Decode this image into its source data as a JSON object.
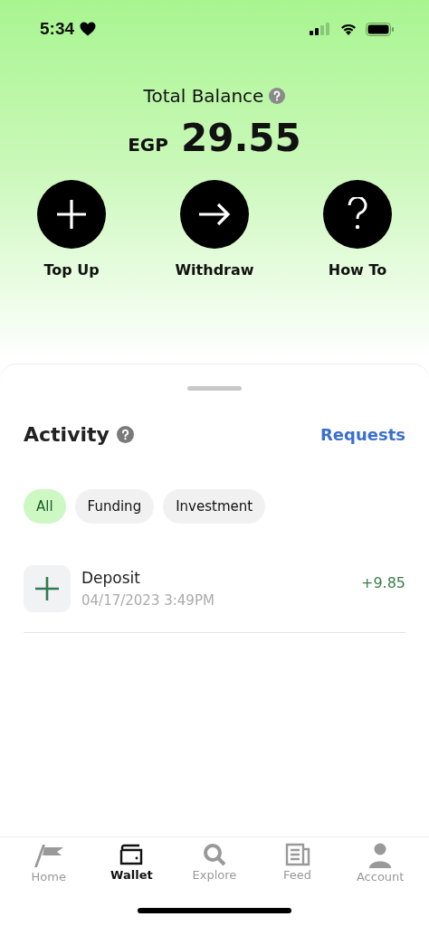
{
  "status_bar": {
    "time": "5:34"
  },
  "balance": {
    "label": "Total Balance",
    "currency": "EGP",
    "amount": "29.55"
  },
  "actions": [
    {
      "label": "Top Up"
    },
    {
      "label": "Withdraw"
    },
    {
      "label": "How To"
    }
  ],
  "activity": {
    "title": "Activity",
    "link": "Requests",
    "filters": [
      {
        "label": "All",
        "selected": true
      },
      {
        "label": "Funding",
        "selected": false
      },
      {
        "label": "Investment",
        "selected": false
      }
    ],
    "transactions": [
      {
        "title": "Deposit",
        "date": "04/17/2023 3:49PM",
        "amount": "+9.85"
      }
    ]
  },
  "tab_bar": [
    {
      "label": "Home",
      "selected": false
    },
    {
      "label": "Wallet",
      "selected": true
    },
    {
      "label": "Explore",
      "selected": false
    },
    {
      "label": "Feed",
      "selected": false
    },
    {
      "label": "Account",
      "selected": false
    }
  ]
}
